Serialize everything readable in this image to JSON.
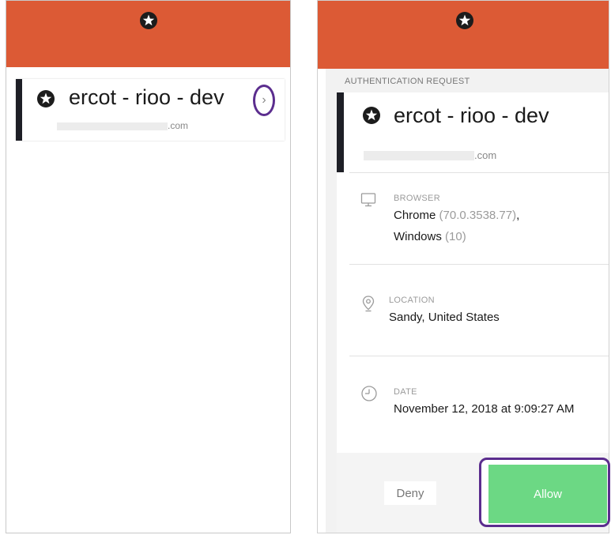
{
  "left_screen": {
    "tenant": {
      "name": "ercot - rioo - dev",
      "domain_suffix": ".com"
    },
    "chevron": "›"
  },
  "right_screen": {
    "section_label": "AUTHENTICATION REQUEST",
    "tenant": {
      "name": "ercot - rioo - dev",
      "domain_suffix": ".com"
    },
    "browser": {
      "label": "BROWSER",
      "name": "Chrome",
      "version": "(70.0.3538.77)",
      "sep": ",",
      "os": "Windows",
      "os_version": "(10)"
    },
    "location": {
      "label": "LOCATION",
      "value": "Sandy, United States"
    },
    "date": {
      "label": "DATE",
      "value": "November 12, 2018 at 9:09:27 AM"
    },
    "actions": {
      "deny": "Deny",
      "allow": "Allow"
    }
  },
  "colors": {
    "header": "#dc5a35",
    "card_bar": "#1e1f26",
    "allow": "#6cd884",
    "highlight": "#5b2d8e"
  },
  "icons": [
    "auth0-shield-icon",
    "chevron-right-icon",
    "monitor-icon",
    "location-pin-icon",
    "clock-icon"
  ]
}
